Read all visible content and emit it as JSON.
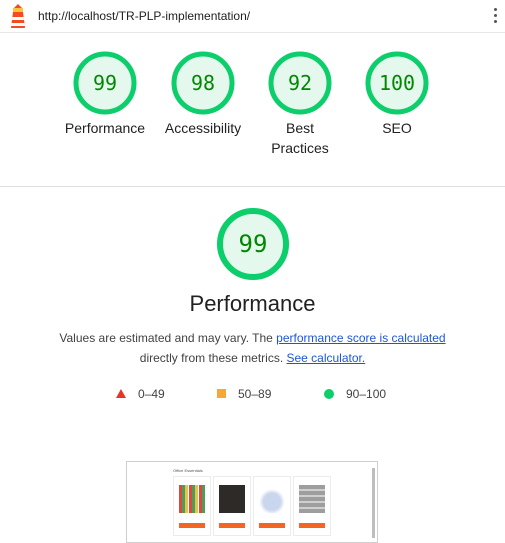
{
  "header": {
    "url": "http://localhost/TR-PLP-implementation/"
  },
  "summary": {
    "gauges": [
      {
        "score": "99",
        "label": "Performance",
        "value": 99
      },
      {
        "score": "98",
        "label": "Accessibility",
        "value": 98
      },
      {
        "score": "92",
        "label": "Best Practices",
        "value": 92
      },
      {
        "score": "100",
        "label": "SEO",
        "value": 100
      }
    ]
  },
  "performance": {
    "score": "99",
    "value": 99,
    "title": "Performance",
    "desc_prefix": "Values are estimated and may vary. The ",
    "desc_link1": "performance score is calculated",
    "desc_mid": " directly from these metrics. ",
    "desc_link2": "See calculator."
  },
  "legend": {
    "poor": "0–49",
    "average": "50–89",
    "good": "90–100"
  },
  "colors": {
    "pass": "#0cce6b",
    "pass_text": "#008800",
    "pass_bg": "#e5f8ee",
    "average": "#f4a935",
    "fail": "#eb3323"
  },
  "thumbnail": {
    "title": "Office Essentials"
  }
}
